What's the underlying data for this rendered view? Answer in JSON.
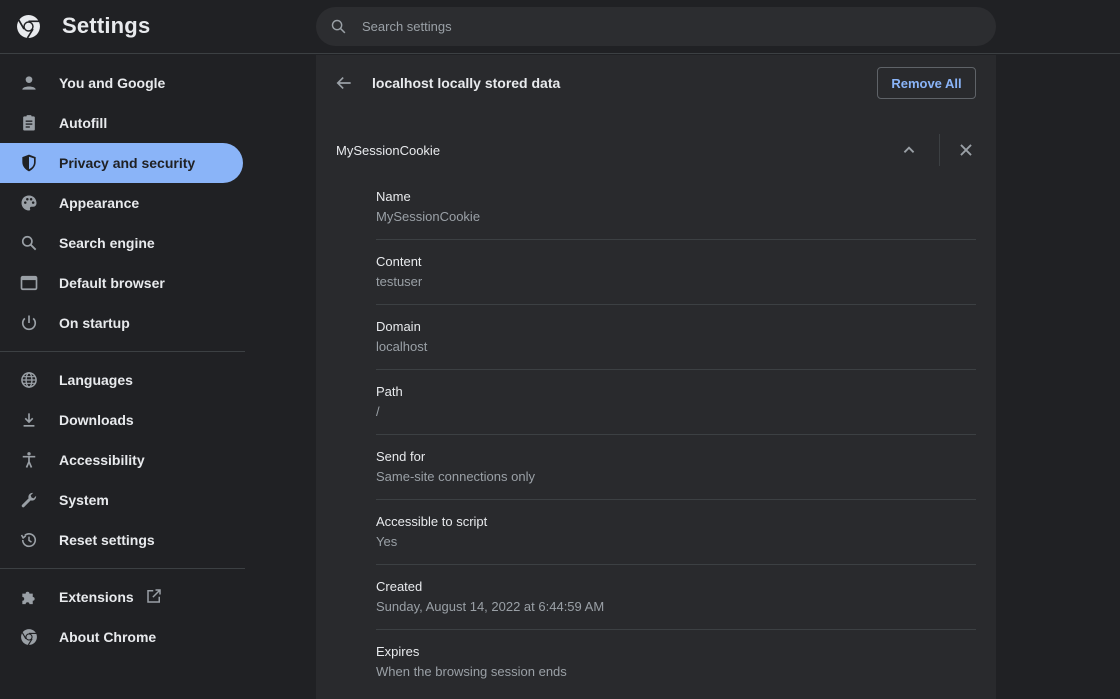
{
  "header": {
    "title": "Settings",
    "search_placeholder": "Search settings",
    "search_value": ""
  },
  "sidebar": {
    "group1": [
      {
        "label": "You and Google",
        "icon": "person-icon"
      },
      {
        "label": "Autofill",
        "icon": "clipboard-icon"
      },
      {
        "label": "Privacy and security",
        "icon": "shield-icon",
        "active": true
      },
      {
        "label": "Appearance",
        "icon": "palette-icon"
      },
      {
        "label": "Search engine",
        "icon": "search-icon"
      },
      {
        "label": "Default browser",
        "icon": "browser-window-icon"
      },
      {
        "label": "On startup",
        "icon": "power-icon"
      }
    ],
    "group2": [
      {
        "label": "Languages",
        "icon": "globe-icon"
      },
      {
        "label": "Downloads",
        "icon": "download-icon"
      },
      {
        "label": "Accessibility",
        "icon": "accessibility-icon"
      },
      {
        "label": "System",
        "icon": "wrench-icon"
      },
      {
        "label": "Reset settings",
        "icon": "history-icon"
      }
    ],
    "group3": [
      {
        "label": "Extensions",
        "icon": "puzzle-icon"
      },
      {
        "label": "About Chrome",
        "icon": "chrome-icon"
      }
    ]
  },
  "panel": {
    "title": "localhost locally stored data",
    "remove_all_label": "Remove All",
    "cookie_name": "MySessionCookie",
    "fields": [
      {
        "label": "Name",
        "value": "MySessionCookie"
      },
      {
        "label": "Content",
        "value": "testuser"
      },
      {
        "label": "Domain",
        "value": "localhost"
      },
      {
        "label": "Path",
        "value": "/"
      },
      {
        "label": "Send for",
        "value": "Same-site connections only"
      },
      {
        "label": "Accessible to script",
        "value": "Yes"
      },
      {
        "label": "Created",
        "value": "Sunday, August 14, 2022 at 6:44:59 AM"
      },
      {
        "label": "Expires",
        "value": "When the browsing session ends"
      }
    ]
  },
  "colors": {
    "accent": "#8ab4f8",
    "background": "#202124",
    "panel": "#292a2d",
    "secondary_text": "#9aa0a6"
  }
}
